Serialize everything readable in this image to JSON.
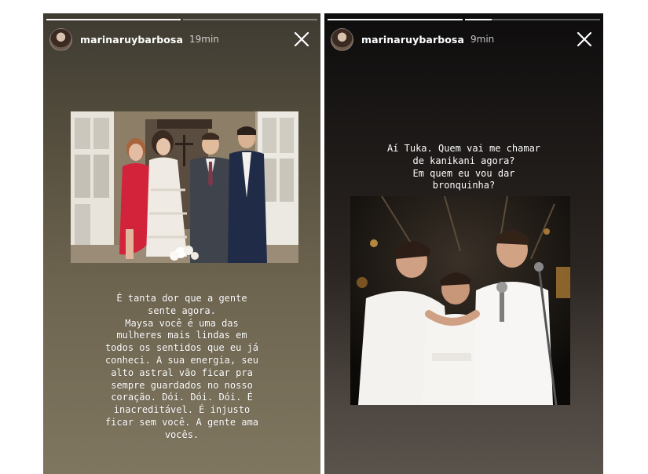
{
  "stories": {
    "left": {
      "progress": [
        1.0,
        0.0
      ],
      "username": "marinaruybarbosa",
      "time": "19min",
      "caption": "É tanta dor que a gente\nsente agora.\nMaysa você é uma das\nmulheres mais lindas em\ntodos os sentidos que eu já\nconheci. A sua energia, seu\nalto astral vão ficar pra\nsempre guardados no nosso\ncoração. Dói. Dói. Dói. É\ninacreditável. É injusto\nficar sem você. A gente ama\nvocês."
    },
    "right": {
      "progress": [
        1.0,
        0.2
      ],
      "username": "marinaruybarbosa",
      "time": "9min",
      "caption": "Aí Tuka. Quem vai me chamar\nde kanikani agora?\nEm quem eu vou dar\nbronquinha?"
    }
  },
  "icons": {
    "close": "close-icon",
    "avatar": "avatar"
  },
  "colors": {
    "text": "#ffffff",
    "progress_track": "rgba(255,255,255,0.35)",
    "progress_fill": "#ffffff"
  }
}
